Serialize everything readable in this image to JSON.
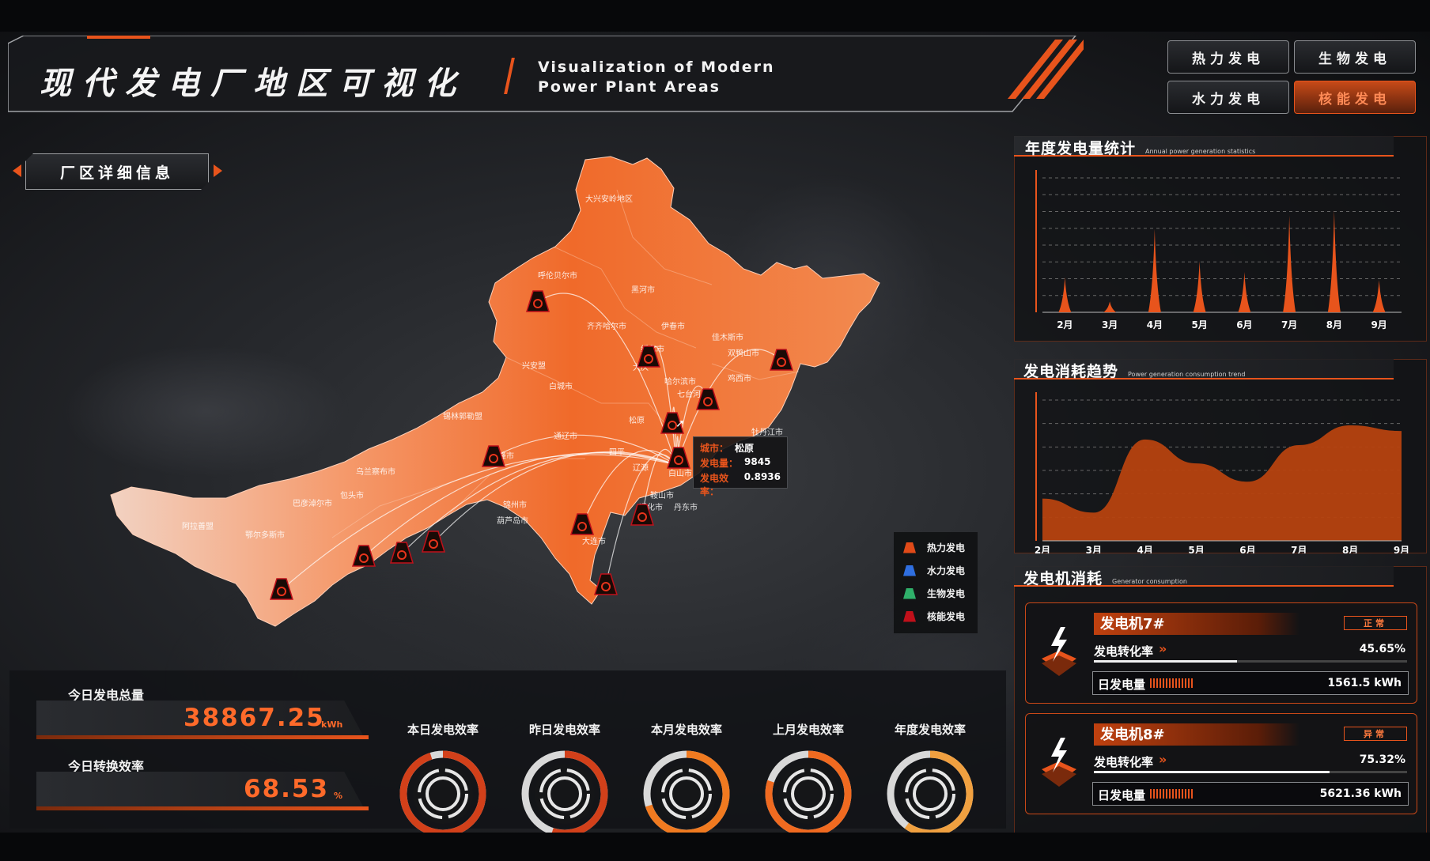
{
  "header": {
    "title_cn": "现代发电厂地区可视化",
    "title_en_line1": "Visualization of Modern",
    "title_en_line2": "Power Plant Areas"
  },
  "top_buttons": [
    {
      "label": "热力发电",
      "active": false
    },
    {
      "label": "生物发电",
      "active": false
    },
    {
      "label": "水力发电",
      "active": false
    },
    {
      "label": "核能发电",
      "active": true
    }
  ],
  "section_button": "厂区详细信息",
  "map": {
    "city_labels": [
      "大兴安岭地区",
      "呼伦贝尔市",
      "黑河市",
      "齐齐哈尔市",
      "伊春市",
      "佳木斯市",
      "绥化市",
      "双鸭山市",
      "兴安盟",
      "大庆",
      "哈尔滨市",
      "七台河",
      "白城市",
      "松原",
      "鸡西市",
      "牡丹江市",
      "通辽市",
      "赤峰市",
      "四平",
      "辽源",
      "白山市",
      "锡林郭勒盟",
      "通化市",
      "乌兰察布市",
      "包头市",
      "巴彦淖尔市",
      "阿拉善盟",
      "鄂尔多斯市",
      "锦州市",
      "葫芦岛市",
      "丹东市",
      "大连市",
      "鞍山市"
    ],
    "tooltip": {
      "city_label": "城市：",
      "city_value": "松原",
      "power_label": "发电量：",
      "power_value": "9845",
      "eff_label": "发电效率：",
      "eff_value": "0.8936"
    }
  },
  "legend": [
    {
      "label": "热力发电",
      "color": "#e04a18"
    },
    {
      "label": "水力发电",
      "color": "#2f6fe0"
    },
    {
      "label": "生物发电",
      "color": "#2fb06a"
    },
    {
      "label": "核能发电",
      "color": "#c0101a"
    }
  ],
  "stats": {
    "total_label": "今日发电总量",
    "total_value": "38867.25",
    "total_unit": "kWh",
    "eff_label": "今日转换效率",
    "eff_value": "68.53",
    "eff_unit": "%"
  },
  "gauges": [
    {
      "label": "本日发电效率",
      "fill": 0.95,
      "color": "#d2401a"
    },
    {
      "label": "昨日发电效率",
      "fill": 0.55,
      "color": "#d2401a"
    },
    {
      "label": "本月发电效率",
      "fill": 0.7,
      "color": "#f07a20"
    },
    {
      "label": "上月发电效率",
      "fill": 0.8,
      "color": "#f06a20"
    },
    {
      "label": "年度发电效率",
      "fill": 0.6,
      "color": "#f0a040"
    }
  ],
  "annual_panel": {
    "title": "年度发电量统计",
    "subtitle": "Annual power generation statistics"
  },
  "consumption_panel": {
    "title": "发电消耗趋势",
    "subtitle": "Power generation consumption trend"
  },
  "generator_panel": {
    "title": "发电机消耗",
    "subtitle": "Generator consumption"
  },
  "chart_data": [
    {
      "type": "bar",
      "categories": [
        "2月",
        "3月",
        "4月",
        "5月",
        "6月",
        "7月",
        "8月",
        "9月"
      ],
      "values": [
        26,
        8,
        62,
        38,
        30,
        72,
        76,
        24
      ],
      "ylim": [
        0,
        100
      ],
      "grid": true
    },
    {
      "type": "area",
      "categories": [
        "2月",
        "3月",
        "4月",
        "5月",
        "6月",
        "7月",
        "8月",
        "9月"
      ],
      "values": [
        30,
        20,
        72,
        55,
        42,
        68,
        82,
        78
      ],
      "ylim": [
        0,
        100
      ],
      "grid": true
    }
  ],
  "generators": [
    {
      "name": "发电机7#",
      "status": "正常",
      "rate_label": "发电转化率",
      "rate_value": "45.65%",
      "rate_fill": 0.4565,
      "daily_label": "日发电量",
      "daily_value": "1561.5 kWh"
    },
    {
      "name": "发电机8#",
      "status": "异常",
      "rate_label": "发电转化率",
      "rate_value": "75.32%",
      "rate_fill": 0.7532,
      "daily_label": "日发电量",
      "daily_value": "5621.36 kWh"
    }
  ]
}
